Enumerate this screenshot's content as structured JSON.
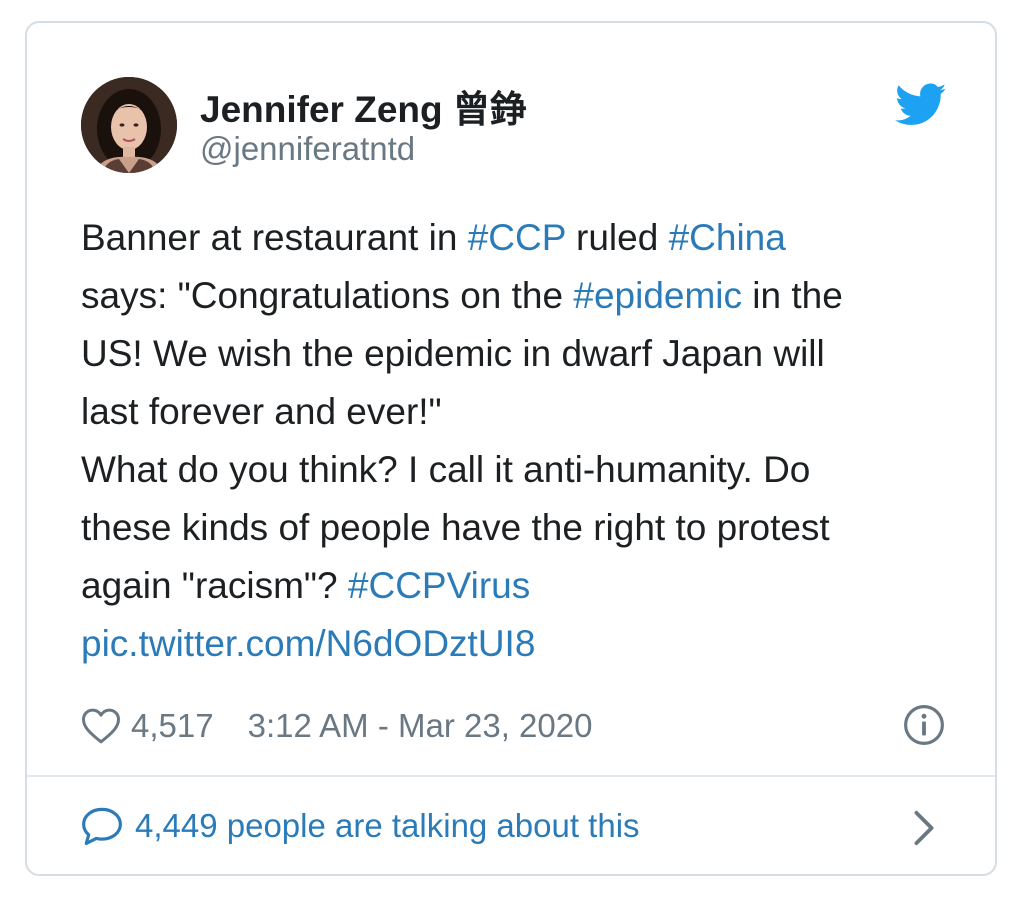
{
  "author": {
    "name": "Jennifer Zeng 曾錚",
    "handle": "@jenniferatntd"
  },
  "icons": {
    "avatar": "avatar-photo",
    "logo": "twitter-bird-icon",
    "like": "heart-icon",
    "info": "info-icon",
    "replies": "speech-bubble-icon",
    "more": "chevron-right-icon"
  },
  "colors": {
    "link": "#2b7bb9",
    "twitter_blue": "#1da1f2",
    "muted": "#697882",
    "border": "#d6dee4"
  },
  "tweet": {
    "lines": [
      [
        {
          "t": "Banner at restaurant in "
        },
        {
          "t": "#CCP",
          "link": true
        },
        {
          "t": " ruled "
        },
        {
          "t": "#China",
          "link": true
        }
      ],
      [
        {
          "t": "says: \"Congratulations on the "
        },
        {
          "t": "#epidemic",
          "link": true
        },
        {
          "t": " in the"
        }
      ],
      [
        {
          "t": "US! We wish the epidemic in dwarf Japan will"
        }
      ],
      [
        {
          "t": "last forever and ever!\""
        }
      ],
      [
        {
          "t": "What do you think? I call it anti-humanity. Do"
        }
      ],
      [
        {
          "t": "these kinds of people have the right to protest"
        }
      ],
      [
        {
          "t": "again \"racism\"? "
        },
        {
          "t": "#CCPVirus",
          "link": true
        }
      ],
      [
        {
          "t": "pic.twitter.com/N6dODztUI8",
          "link": true
        }
      ]
    ]
  },
  "meta": {
    "likes": "4,517",
    "timestamp": "3:12 AM - Mar 23, 2020"
  },
  "footer": {
    "talking": "4,449 people are talking about this"
  }
}
